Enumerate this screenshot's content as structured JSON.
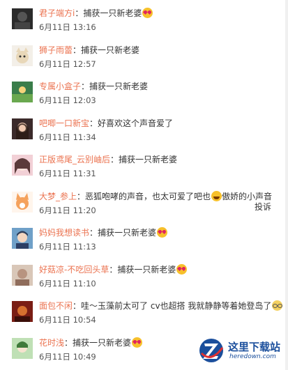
{
  "comments": [
    {
      "user": "君子端方i",
      "sep": "：",
      "text": "捕获一只新老婆",
      "emoji": "love",
      "time": "6月11日 13:16",
      "avatar": "dark"
    },
    {
      "user": "狮子雨蕾",
      "sep": "：",
      "text": "捕获一只新老婆",
      "emoji": "",
      "time": "6月11日 12:57",
      "avatar": "cat"
    },
    {
      "user": "专属小盒子",
      "sep": "：",
      "text": "捕获一只新老婆",
      "emoji": "",
      "time": "6月11日 12:03",
      "avatar": "nature"
    },
    {
      "user": "吧唧一口新宝",
      "sep": "：",
      "text": "好喜欢这个声音爱了",
      "emoji": "",
      "time": "6月11日 11:34",
      "avatar": "girl"
    },
    {
      "user": "正版鸢尾_云别岫后",
      "sep": "：",
      "text": "捕获一只新老婆",
      "emoji": "",
      "time": "6月11日 11:31",
      "avatar": "anime"
    },
    {
      "user": "大梦_参上",
      "sep": "：",
      "text": "恶狐咆哮的声音，也太可爱了吧也",
      "emoji": "laugh",
      "text2": "傲娇的小声音",
      "time": "6月11日 11:20",
      "avatar": "fox",
      "report": "投诉"
    },
    {
      "user": "妈妈我想读书",
      "sep": "：",
      "text": "捕获一只新老婆",
      "emoji": "love",
      "time": "6月11日 11:13",
      "avatar": "boy"
    },
    {
      "user": "好菇凉-不吃回头草",
      "sep": "：",
      "text": "捕获一只新老婆",
      "emoji": "love",
      "time": "6月11日 11:10",
      "avatar": "blur"
    },
    {
      "user": "面包不闲",
      "sep": "：",
      "text": "哇～玉藻前太可了 cv也超搭 我就静静等着她登岛了",
      "emoji": "glasses",
      "time": "6月11日 10:54",
      "avatar": "red"
    },
    {
      "user": "花时浅",
      "sep": "：",
      "text": "捕获一只新老婆",
      "emoji": "love",
      "time": "6月11日 10:49",
      "avatar": "green"
    }
  ],
  "watermark": {
    "title": "这里下载站",
    "url": "heredown.com"
  }
}
